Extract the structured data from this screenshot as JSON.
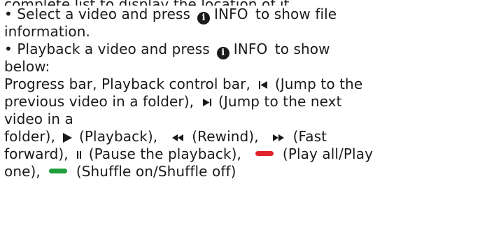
{
  "intro_fragment": "complete list to display the location of it.",
  "bullet": "•",
  "info_button_glyph": "i",
  "info_label": "INFO",
  "line1a": "Select a video and press",
  "line1b": "to show file",
  "line2": "information.",
  "line3a": "Playback a video and press",
  "line3b": "to show",
  "line4": "below:",
  "line5a": "Progress bar, Playback control bar,",
  "line5b": "(Jump to the",
  "line6a": "previous video in a folder),",
  "line6b": "(Jump to the next",
  "line7": "video in a",
  "line8a": "folder),",
  "line8b": "(Playback),",
  "line8c": "(Rewind),",
  "line8d": "(Fast",
  "line9a": "forward),",
  "line9b": "(Pause the playback),",
  "line9c": "(Play all/Play",
  "line10a": "one),",
  "line10b": "(Shuffle on/Shuffle off)",
  "icons": {
    "info": "info-icon",
    "previous": "skip-previous-icon",
    "next": "skip-next-icon",
    "play": "play-icon",
    "rewind": "rewind-icon",
    "fast_forward": "fast-forward-icon",
    "pause": "pause-icon",
    "red_button": "red-button-icon",
    "green_button": "green-button-icon"
  },
  "colors": {
    "text": "#1a1a1a",
    "red": "#e0242b",
    "green": "#1f9e3a"
  }
}
